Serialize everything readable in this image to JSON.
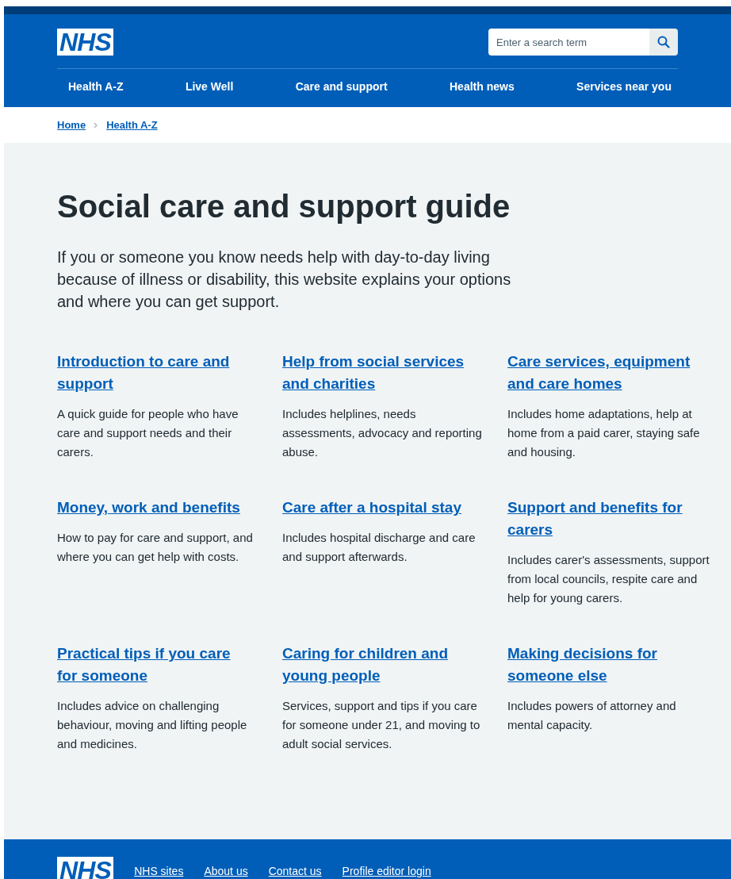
{
  "header": {
    "logo": "NHS",
    "search": {
      "placeholder": "Enter a search term"
    },
    "nav": [
      "Health A-Z",
      "Live Well",
      "Care and support",
      "Health news",
      "Services near you"
    ]
  },
  "breadcrumbs": [
    "Home",
    "Health A-Z"
  ],
  "title": "Social care and support guide",
  "lead": "If you or someone you know needs help with day-to-day living because of illness or disability, this website explains your options and where you can get support.",
  "cards": [
    {
      "title": "Introduction to care and support",
      "description": "A quick guide for people who have care and support needs and their carers."
    },
    {
      "title": "Help from social services and charities",
      "description": "Includes helplines, needs assessments, advocacy and reporting abuse."
    },
    {
      "title": "Care services, equipment and care homes",
      "description": "Includes home adaptations, help at home from a paid carer, staying safe and housing."
    },
    {
      "title": "Money, work and benefits",
      "description": "How to pay for care and support, and where you can get help with costs."
    },
    {
      "title": "Care after a hospital stay",
      "description": "Includes hospital discharge and care and support afterwards."
    },
    {
      "title": "Support and benefits for carers",
      "description": "Includes carer's assessments, support from local councils, respite care and help for young carers."
    },
    {
      "title": "Practical tips if you care for someone",
      "description": "Includes advice on challenging behaviour, moving and lifting people and medicines."
    },
    {
      "title": "Caring for children and young people",
      "description": "Services, support and tips if you care for someone under 21, and moving to adult social services."
    },
    {
      "title": "Making decisions for someone else",
      "description": "Includes powers of attorney and mental capacity."
    }
  ],
  "footer": {
    "logo": "NHS",
    "links": [
      "NHS sites",
      "About us",
      "Contact us",
      "Profile editor login"
    ]
  }
}
